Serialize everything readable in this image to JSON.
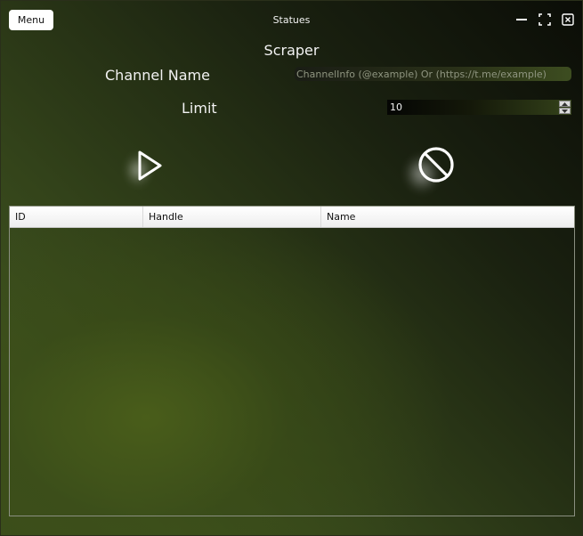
{
  "window": {
    "title": "Statues",
    "menu_label": "Menu"
  },
  "header": {
    "heading": "Scraper"
  },
  "form": {
    "channel_label": "Channel Name",
    "channel_placeholder": "ChannelInfo (@example) Or (https://t.me/example)",
    "channel_value": "",
    "limit_label": "Limit",
    "limit_value": "10"
  },
  "actions": {
    "start_icon": "play-icon",
    "stop_icon": "block-icon"
  },
  "table": {
    "columns": [
      "ID",
      "Handle",
      "Name"
    ],
    "rows": []
  },
  "colors": {
    "background_dark": "#0b0d07",
    "background_green": "#3f5320",
    "text": "#f2f2f2"
  }
}
